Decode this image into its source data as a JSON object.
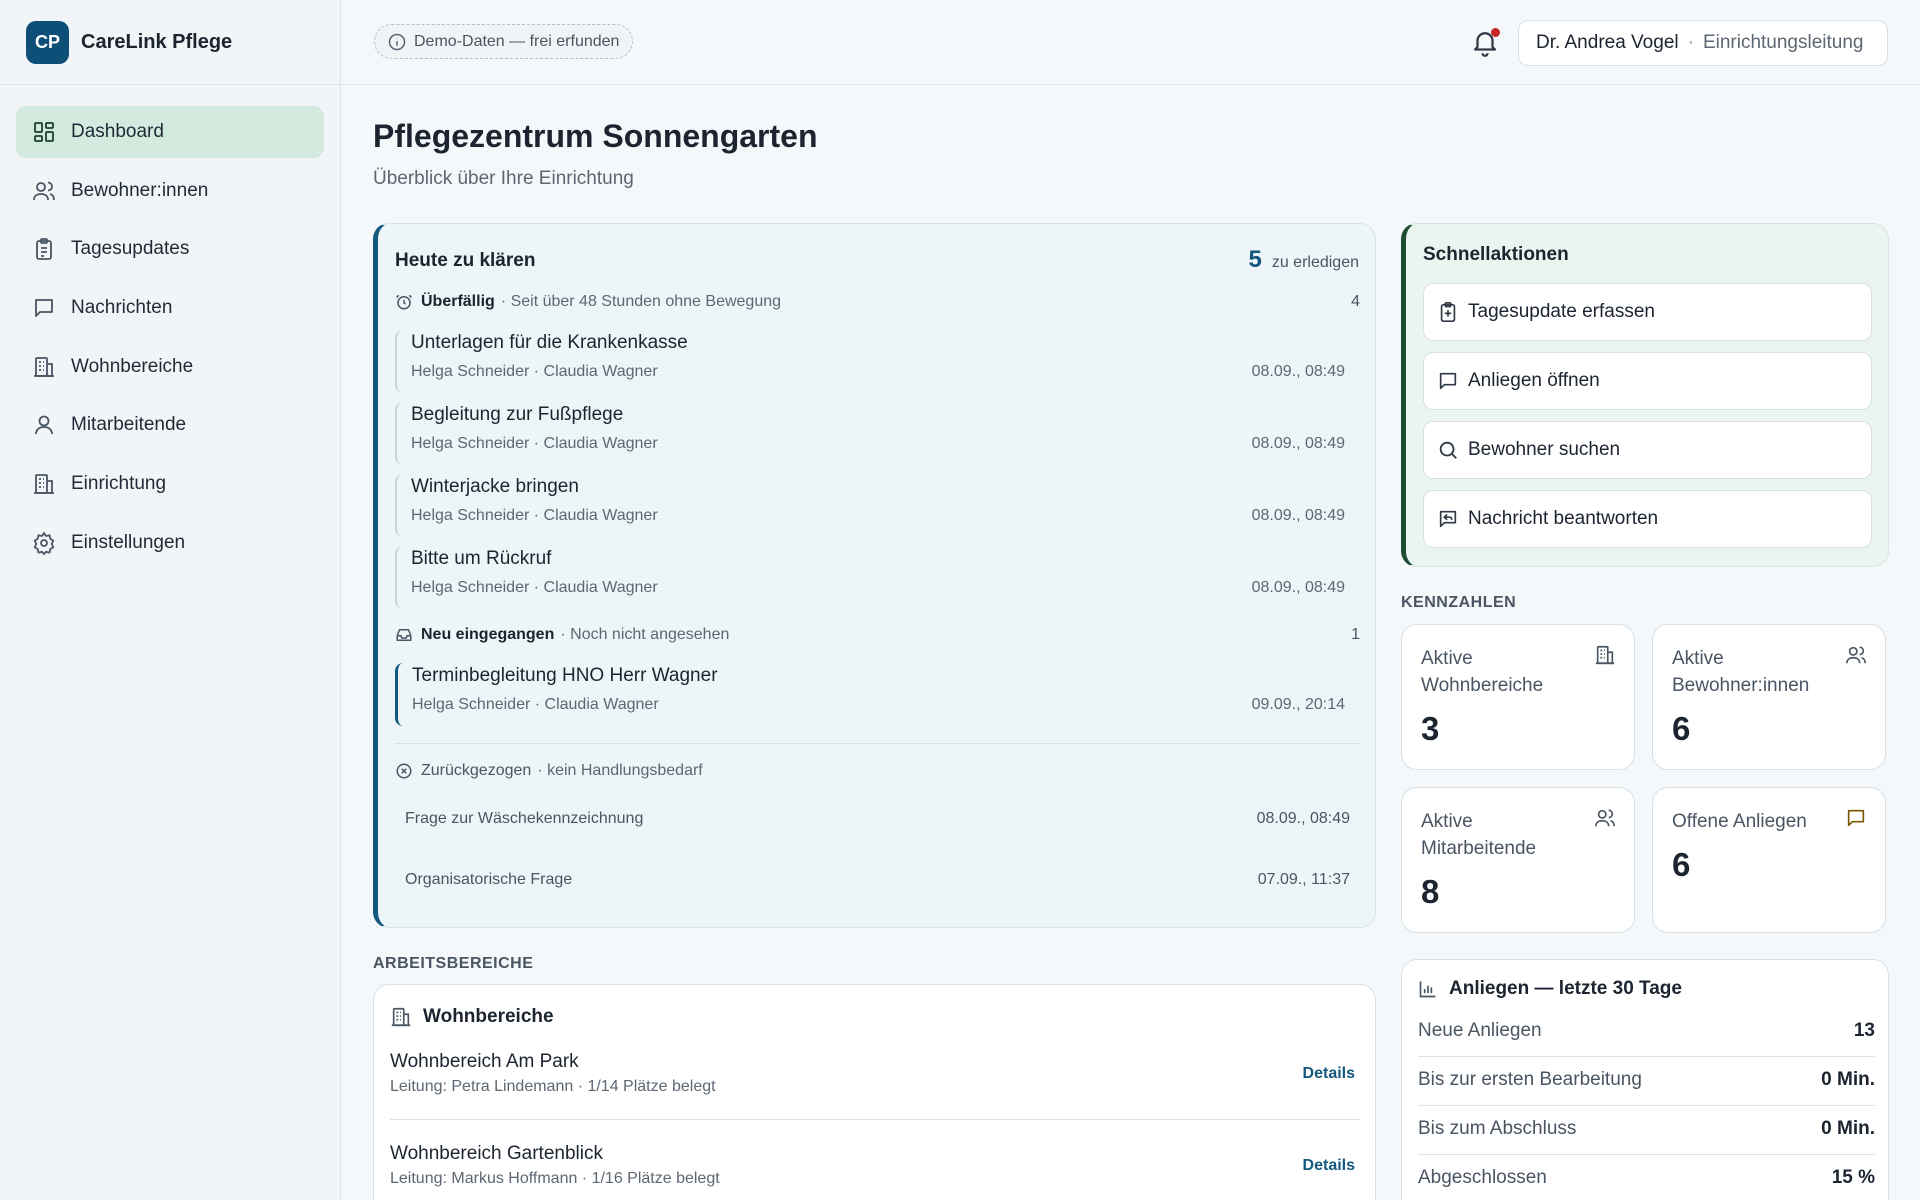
{
  "brand": {
    "initials": "CP",
    "name": "CareLink Pflege"
  },
  "sidebar": {
    "items": [
      {
        "label": "Dashboard",
        "icon": "dashboard-icon",
        "active": true
      },
      {
        "label": "Bewohner:innen",
        "icon": "residents-icon"
      },
      {
        "label": "Tagesupdates",
        "icon": "clipboard-icon"
      },
      {
        "label": "Nachrichten",
        "icon": "message-icon"
      },
      {
        "label": "Wohnbereiche",
        "icon": "building-icon"
      },
      {
        "label": "Mitarbeitende",
        "icon": "staff-icon"
      },
      {
        "label": "Einrichtung",
        "icon": "facility-icon"
      },
      {
        "label": "Einstellungen",
        "icon": "gear-icon"
      }
    ]
  },
  "topbar": {
    "demo_badge": "Demo-Daten — frei erfunden",
    "user_name": "Dr. Andrea Vogel",
    "user_separator": "·",
    "user_role": "Einrichtungsleitung"
  },
  "page": {
    "title": "Pflegezentrum Sonnengarten",
    "subtitle": "Überblick über Ihre Einrichtung"
  },
  "todo": {
    "title": "Heute zu klären",
    "count": "5",
    "count_label": "zu erledigen",
    "overdue": {
      "name": "Überfällig",
      "hint": "· Seit über 48 Stunden ohne Bewegung",
      "count": "4",
      "items": [
        {
          "title": "Unterlagen für die Krankenkasse",
          "meta": "Helga Schneider · Claudia Wagner",
          "date": "08.09., 08:49"
        },
        {
          "title": "Begleitung zur Fußpflege",
          "meta": "Helga Schneider · Claudia Wagner",
          "date": "08.09., 08:49"
        },
        {
          "title": "Winterjacke bringen",
          "meta": "Helga Schneider · Claudia Wagner",
          "date": "08.09., 08:49"
        },
        {
          "title": "Bitte um Rückruf",
          "meta": "Helga Schneider · Claudia Wagner",
          "date": "08.09., 08:49"
        }
      ]
    },
    "new": {
      "name": "Neu eingegangen",
      "hint": "· Noch nicht angesehen",
      "count": "1",
      "items": [
        {
          "title": "Terminbegleitung HNO Herr Wagner",
          "meta": "Helga Schneider · Claudia Wagner",
          "date": "09.09., 20:14"
        }
      ]
    },
    "withdrawn": {
      "name": "Zurückgezogen",
      "hint": "· kein Handlungsbedarf",
      "items": [
        {
          "title": "Frage zur Wäschekennzeichnung",
          "date": "08.09., 08:49"
        },
        {
          "title": "Organisatorische Frage",
          "date": "07.09., 11:37"
        }
      ]
    }
  },
  "quick": {
    "title": "Schnellaktionen",
    "actions": [
      {
        "label": "Tagesupdate erfassen",
        "icon": "clipboard-plus-icon"
      },
      {
        "label": "Anliegen öffnen",
        "icon": "message-icon"
      },
      {
        "label": "Bewohner suchen",
        "icon": "search-icon"
      },
      {
        "label": "Nachricht beantworten",
        "icon": "reply-icon"
      }
    ]
  },
  "kpis": {
    "section_label": "KENNZAHLEN",
    "items": [
      {
        "label": "Aktive Wohnbereiche",
        "value": "3",
        "icon": "building-icon"
      },
      {
        "label": "Aktive Bewohner:innen",
        "value": "6",
        "icon": "residents-icon"
      },
      {
        "label": "Aktive Mitarbeitende",
        "value": "8",
        "icon": "staff-icon"
      },
      {
        "label": "Offene Anliegen",
        "value": "6",
        "icon": "message-icon",
        "accent": "#7a5a00"
      }
    ]
  },
  "work_areas": {
    "section_label": "ARBEITSBEREICHE",
    "card_title": "Wohnbereiche",
    "items": [
      {
        "name": "Wohnbereich Am Park",
        "sub": "Leitung: Petra Lindemann · 1/14 Plätze belegt",
        "action": "Details"
      },
      {
        "name": "Wohnbereich Gartenblick",
        "sub": "Leitung: Markus Hoffmann · 1/16 Plätze belegt",
        "action": "Details"
      }
    ]
  },
  "stats": {
    "title": "Anliegen — letzte 30 Tage",
    "rows": [
      {
        "label": "Neue Anliegen",
        "value": "13"
      },
      {
        "label": "Bis zur ersten Bearbeitung",
        "value": "0 Min."
      },
      {
        "label": "Bis zum Abschluss",
        "value": "0 Min."
      },
      {
        "label": "Abgeschlossen",
        "value": "15 %"
      }
    ]
  },
  "colors": {
    "brand": "#0e4f78",
    "active_nav": "#d3eade",
    "todo_accent": "#13587f",
    "quick_accent": "#1e4d34",
    "notification_dot": "#c62828"
  }
}
